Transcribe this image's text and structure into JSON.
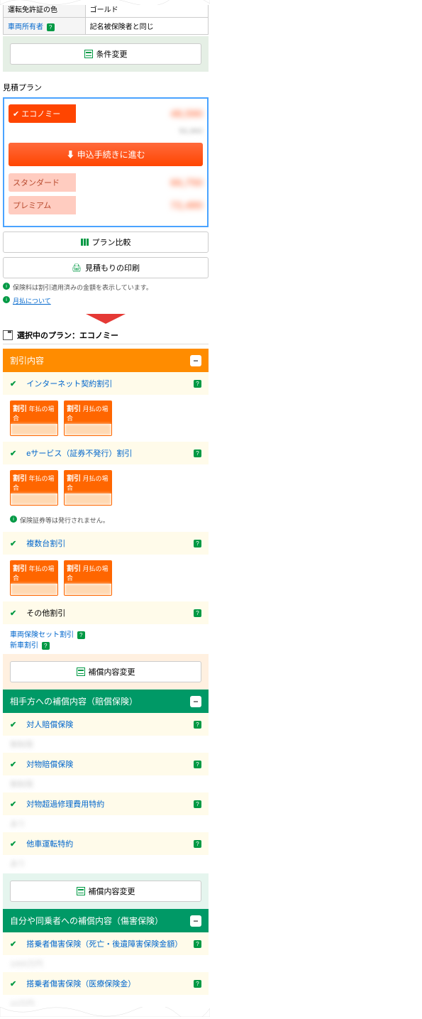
{
  "conditions": {
    "license_color_label": "運転免許証の色",
    "license_color_value": "ゴールド",
    "owner_label": "車両所有者",
    "owner_value": "記名被保険者と同じ"
  },
  "buttons": {
    "change_conditions": "条件変更",
    "proceed": "申込手続きに進む",
    "compare": "プラン比較",
    "print": "見積もりの印刷",
    "change_coverage": "補償内容変更"
  },
  "section_titles": {
    "plans": "見積プラン",
    "selected": "選択中のプラン：エコノミー"
  },
  "plans": {
    "economy": "エコノミー",
    "standard": "スタンダード",
    "premium": "プレミアム",
    "price_blur1": "48,590",
    "price_blur2": "66,750",
    "price_blur3": "72,480",
    "sub_blur": "50,960"
  },
  "notes": {
    "applied": "保険料は割引適用済みの金額を表示しています。",
    "monthly": "月払について",
    "no_cert": "保険証券等は発行されません。"
  },
  "accordions": {
    "discounts": "割引内容",
    "liability": "相手方への補償内容（賠償保険）",
    "injury": "自分や同乗者への補償内容（傷害保険）"
  },
  "discounts": [
    {
      "name": "インターネット契約割引"
    },
    {
      "name": "eサービス（証券不発行）割引"
    },
    {
      "name": "複数台割引"
    },
    {
      "name": "その他割引"
    }
  ],
  "badge": {
    "prefix": "割引",
    "annual": "年払の場合",
    "monthly": "月払の場合"
  },
  "other_discounts": {
    "set": "車両保険セット割引",
    "newcar": "新車割引"
  },
  "liability_items": [
    "対人賠償保険",
    "対物賠償保険",
    "対物超過修理費用特約",
    "他車運転特約"
  ],
  "injury_items": [
    "搭乗者傷害保険（死亡・後遺障害保険金額）",
    "搭乗者傷害保険（医療保険金）"
  ]
}
